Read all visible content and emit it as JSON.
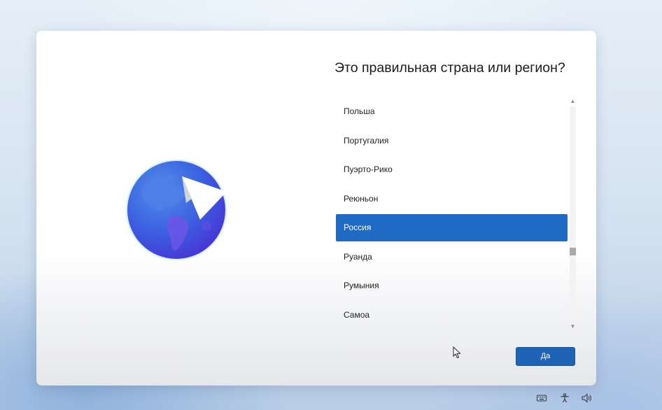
{
  "title": "Это правильная страна или регион?",
  "countries": [
    {
      "label": "Польша",
      "selected": false
    },
    {
      "label": "Португалия",
      "selected": false
    },
    {
      "label": "Пуэрто-Рико",
      "selected": false
    },
    {
      "label": "Реюньон",
      "selected": false
    },
    {
      "label": "Россия",
      "selected": true
    },
    {
      "label": "Руанда",
      "selected": false
    },
    {
      "label": "Румыния",
      "selected": false
    },
    {
      "label": "Самоа",
      "selected": false
    }
  ],
  "buttons": {
    "yes_label": "Да"
  },
  "scroll": {
    "position_fraction": 0.69
  },
  "tray_icons": [
    "keyboard-icon",
    "accessibility-icon",
    "volume-icon"
  ],
  "colors": {
    "accent": "#1f6bc4",
    "button": "#1f63b6",
    "globe_dark": "#3a32d6",
    "globe_light": "#4d8ee8"
  }
}
